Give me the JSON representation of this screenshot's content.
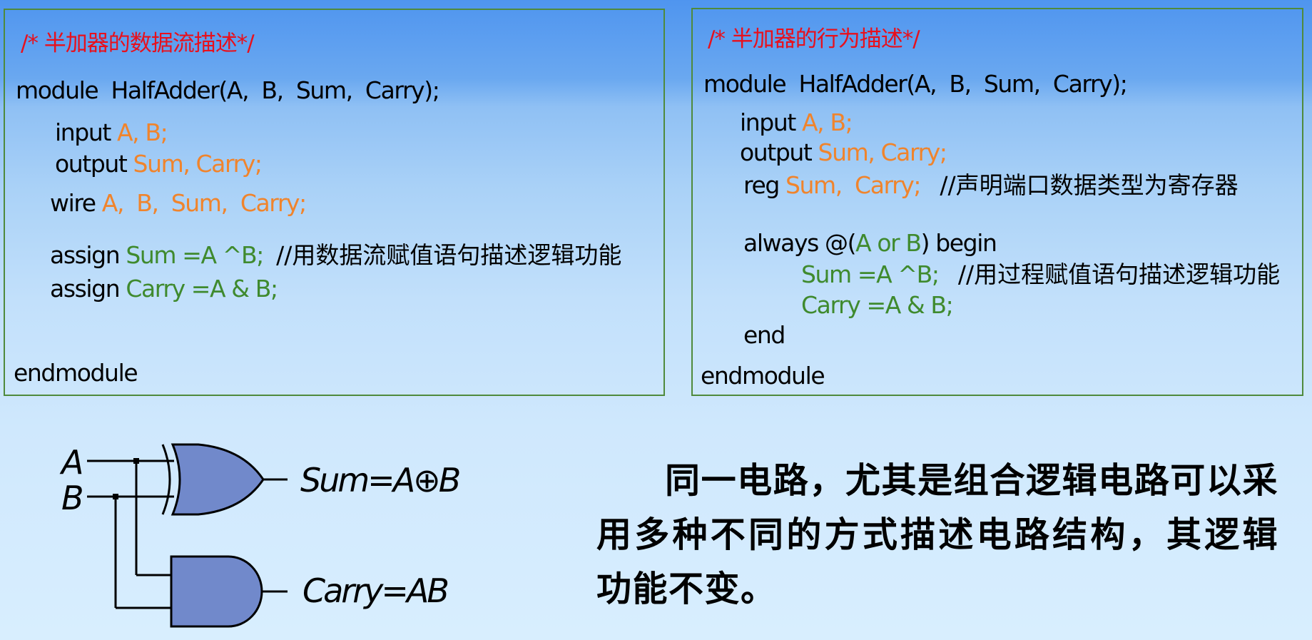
{
  "left_panel": {
    "comment": "/* 半加器的数据流描述*/",
    "module_line": "module  HalfAdder(A,  B,  Sum,  Carry);",
    "input_kw": "input ",
    "input_ports": "A, B;",
    "output_kw": "output ",
    "output_ports": "Sum, Carry;",
    "wire_kw": "wire ",
    "wire_ports": "A,  B,  Sum,  Carry;",
    "assign1_kw": "assign ",
    "assign1_expr": "Sum =A ^B;",
    "assign1_comment": "//用数据流赋值语句描述逻辑功能",
    "assign2_kw": "assign ",
    "assign2_expr": "Carry =A & B;",
    "end": "endmodule"
  },
  "right_panel": {
    "comment": "/* 半加器的行为描述*/",
    "module_line": "module  HalfAdder(A,  B,  Sum,  Carry);",
    "input_kw": "input ",
    "input_ports": "A, B;",
    "output_kw": "output ",
    "output_ports": "Sum, Carry;",
    "reg_kw": "reg ",
    "reg_ports": "Sum,  Carry;",
    "reg_comment": "//声明端口数据类型为寄存器",
    "always_kw": "always @(",
    "always_cond": "A or B",
    "always_end": ") begin",
    "stmt1": "Sum =A ^B;",
    "stmt1_comment": "//用过程赋值语句描述逻辑功能",
    "stmt2": "Carry =A & B;",
    "end_kw": "end",
    "endmodule": "endmodule"
  },
  "circuit": {
    "input_a": "A",
    "input_b": "B",
    "sum_label": "Sum=A⊕B",
    "carry_label": "Carry=AB",
    "gates": [
      "xor-gate",
      "and-gate"
    ],
    "gate_fill": "#7189cb"
  },
  "description": "同一电路，尤其是组合逻辑电路可以采用多种不同的方式描述电路结构，其逻辑功能不变。"
}
